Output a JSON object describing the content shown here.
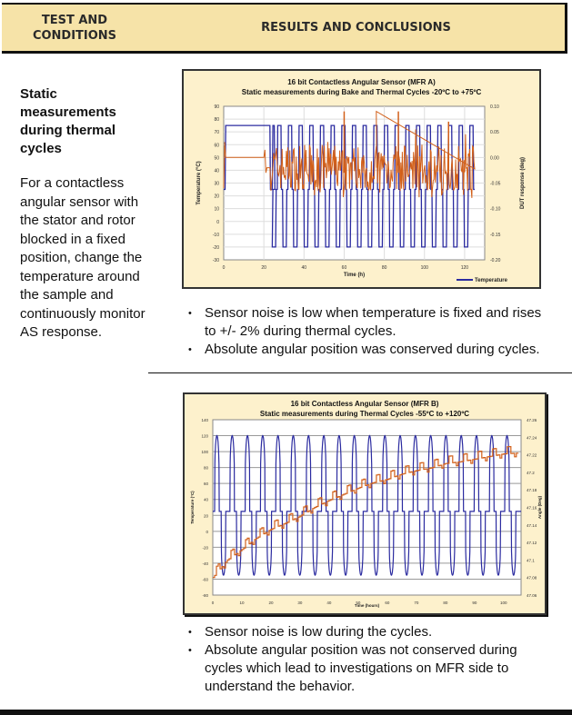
{
  "header": {
    "left_label": "TEST AND CONDITIONS",
    "left_line1": "TEST AND",
    "left_line2": "CONDITIONS",
    "right_label": "RESULTS AND CONCLUSIONS"
  },
  "test": {
    "title": "Static measurements during thermal cycles",
    "description": "For a contactless angular sensor with the stator and rotor blocked in a fixed position, change the temperature around the sample and continuously monitor AS response."
  },
  "results": [
    {
      "bullets": [
        "Sensor noise is low when temperature is fixed and rises to +/- 2% during thermal cycles.",
        "Absolute angular position was conserved during cycles."
      ]
    },
    {
      "bullets": [
        "Sensor noise is low during the cycles.",
        "Absolute angular position was not conserved during cycles which lead to investigations on MFR side to understand the behavior."
      ]
    }
  ],
  "colors": {
    "header_bg": "#f6e3a8",
    "chart_bg": "#fdf1cc",
    "temperature_line": "#2b2ba0",
    "response_line": "#d2601a"
  },
  "chart_data": [
    {
      "type": "line",
      "title": "16 bit Contactless Angular Sensor (MFR A)",
      "subtitle": "Static measurements during Bake and Thermal Cycles -20ºC to +75ºC",
      "xlabel": "Time (h)",
      "ylabel": "Temperature (°C)",
      "y2label": "DUT response (deg)",
      "xlim": [
        0,
        130
      ],
      "ylim": [
        -30,
        90
      ],
      "y2lim": [
        -0.2,
        0.1
      ],
      "xticks": [
        "0",
        "20",
        "40",
        "60",
        "80",
        "100",
        "120"
      ],
      "yticks": [
        "90",
        "80",
        "70",
        "60",
        "50",
        "40",
        "30",
        "20",
        "10",
        "0",
        "-10",
        "-20",
        "-30"
      ],
      "y2ticks": [
        "0.10",
        "0.05",
        "0.00",
        "-0.05",
        "-0.10",
        "-0.15",
        "-0.20"
      ],
      "grid": true,
      "legend": {
        "position": "bottom-right",
        "entries": [
          "Temperature"
        ]
      },
      "series": [
        {
          "name": "Temperature",
          "axis": "left",
          "description": "Bake at 75°C from ~1h to ~23h, then ~19 thermal cycles between -20°C and +75°C with 25°C plateaus, ending ~125h",
          "bake": {
            "start": 1,
            "end": 23,
            "level": 75
          },
          "cycles": {
            "start": 24,
            "end": 125,
            "count": 19,
            "min": -20,
            "max": 75,
            "mid": 25
          }
        },
        {
          "name": "DUT response",
          "axis": "right",
          "description": "Stable ~0.00 deg during bake; noisy oscillation between about -0.08 and +0.03 deg during thermal cycles with spikes up to ~0.09",
          "bake_level": 0.0,
          "cycle_range": [
            -0.08,
            0.03
          ],
          "spikes": [
            0.09,
            0.09,
            0.07
          ]
        }
      ]
    },
    {
      "type": "line",
      "title": "16 bit Contactless Angular Sensor (MFR B)",
      "subtitle": "Static measurements during Thermal Cycles   -55ºC to +120ºC",
      "xlabel": "Time (hours)",
      "ylabel": "Temperature (°C)",
      "y2label": "Angle (Deg)",
      "xlim": [
        0,
        106
      ],
      "ylim": [
        -80,
        140
      ],
      "y2lim": [
        47.06,
        47.26
      ],
      "xticks": [
        "0",
        "10",
        "20",
        "30",
        "40",
        "50",
        "60",
        "70",
        "80",
        "90",
        "100"
      ],
      "yticks": [
        "140",
        "120",
        "100",
        "80",
        "60",
        "40",
        "20",
        "0",
        "-20",
        "-40",
        "-60",
        "-80"
      ],
      "y2ticks": [
        "47.26",
        "47.24",
        "47.22",
        "47.2",
        "47.18",
        "47.16",
        "47.14",
        "47.12",
        "47.1",
        "47.08",
        "47.06"
      ],
      "grid": true,
      "series": [
        {
          "name": "Temperature",
          "axis": "left",
          "description": "~20 thermal cycles between -55°C and +120°C with 25°C plateaus, period ~5h",
          "cycles": {
            "start": 0,
            "end": 105,
            "count": 20,
            "min": -55,
            "max": 120,
            "mid": 25
          }
        },
        {
          "name": "Angle",
          "axis": "right",
          "description": "Stepwise drift upward from ~47.08 deg at t=0 to ~47.22 deg at t=105h",
          "x": [
            0,
            5,
            10,
            15,
            20,
            25,
            30,
            35,
            40,
            45,
            50,
            55,
            60,
            65,
            70,
            75,
            80,
            85,
            90,
            95,
            100,
            105
          ],
          "values": [
            47.08,
            47.1,
            47.112,
            47.125,
            47.135,
            47.142,
            47.15,
            47.16,
            47.168,
            47.175,
            47.182,
            47.188,
            47.192,
            47.198,
            47.202,
            47.205,
            47.21,
            47.212,
            47.215,
            47.218,
            47.221,
            47.222
          ]
        }
      ]
    }
  ]
}
